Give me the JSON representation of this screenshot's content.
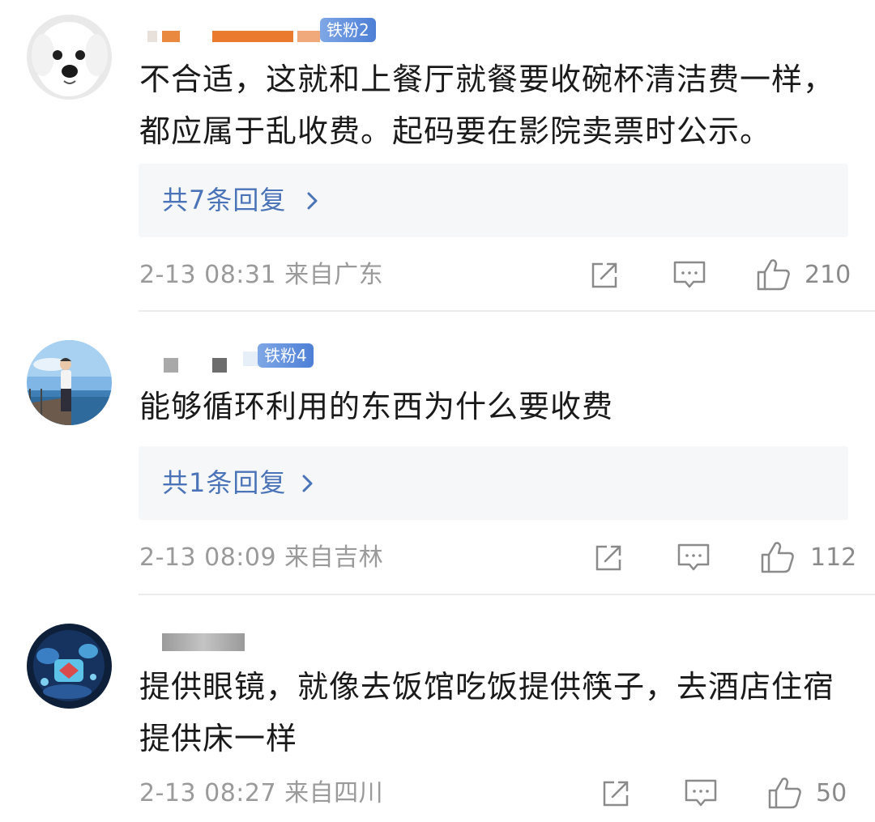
{
  "comments": [
    {
      "badge": "铁粉2",
      "text": "不合适，这就和上餐厅就餐要收碗杯清洁费一样，都应属于乱收费。起码要在影院卖票时公示。",
      "reply_label": "共7条回复",
      "meta": "2-13 08:31 来自广东",
      "likes": "210"
    },
    {
      "badge": "铁粉4",
      "text": "能够循环利用的东西为什么要收费",
      "reply_label": "共1条回复",
      "meta": "2-13 08:09 来自吉林",
      "likes": "112"
    },
    {
      "text": "提供眼镜，就像去饭馆吃饭提供筷子，去酒店住宿提供床一样",
      "meta": "2-13 08:27 来自四川",
      "likes": "50"
    }
  ],
  "icons": {
    "share": "share-icon",
    "comment": "comment-icon",
    "like": "thumbs-up-icon",
    "chevron": "chevron-right-icon"
  },
  "colors": {
    "reply_text": "#4a73b8",
    "badge": "#5b8be0",
    "meta": "#9a9a9a"
  }
}
